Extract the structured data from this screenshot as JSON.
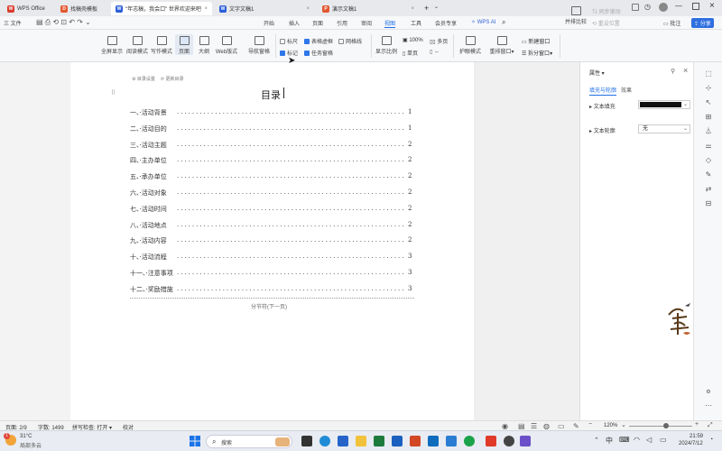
{
  "tabs": [
    {
      "label": "WPS Office",
      "color": "#d93a2b"
    },
    {
      "label": "找稿壳模板",
      "color": "#e3572f"
    },
    {
      "label": "\"年志稿，我会口\" 世界欢迎来吧!...",
      "color": "#2b5fd9",
      "active": true
    },
    {
      "label": "文字文稿1",
      "color": "#2b5fd9"
    },
    {
      "label": "演示文稿1",
      "color": "#e3572f"
    }
  ],
  "topright": {
    "share": "分享"
  },
  "menubar": {
    "file": "三 文件",
    "items": [
      "开始",
      "插入",
      "页面",
      "引用",
      "审阅",
      "视图",
      "工具",
      "会员专享"
    ],
    "wps_ai": "WPS AI",
    "comments": "批注",
    "share": "分享"
  },
  "ribbon": {
    "buttons": [
      "全屏显示",
      "阅读模式",
      "写作模式",
      "页面",
      "大纲",
      "Web版式",
      "导航窗格"
    ],
    "checks": [
      {
        "label": "标尺",
        "checked": false
      },
      {
        "label": "标记",
        "checked": true
      },
      {
        "label": "表格虚框",
        "checked": true
      },
      {
        "label": "任务窗格",
        "checked": true
      },
      {
        "label": "网格线",
        "checked": false
      }
    ],
    "zoom": [
      "显示比例",
      "100%",
      "单页",
      "多页"
    ],
    "tools": [
      "护眼模式",
      "重排窗口",
      "新建窗口",
      "拆分窗口",
      "并排比较",
      "同步滚动",
      "重设位置"
    ]
  },
  "doc": {
    "page_tools": [
      "目录设置",
      "更新目录"
    ],
    "title": "目录",
    "toc": [
      {
        "title": "一、·活动背景",
        "page": "1"
      },
      {
        "title": "二、·活动目的",
        "page": "1"
      },
      {
        "title": "三、·活动主题",
        "page": "2"
      },
      {
        "title": "四、·主办单位",
        "page": "2"
      },
      {
        "title": "五、·承办单位",
        "page": "2"
      },
      {
        "title": "六、·活动对象",
        "page": "2"
      },
      {
        "title": "七、·活动时间",
        "page": "2"
      },
      {
        "title": "八、·活动地点",
        "page": "2"
      },
      {
        "title": "九、·活动内容",
        "page": "2"
      },
      {
        "title": "十、·活动流程",
        "page": "3"
      },
      {
        "title": "十一、·注意事项",
        "page": "3"
      },
      {
        "title": "十二、·奖励措施",
        "page": "3"
      }
    ],
    "section_break": "分节符(下一页)"
  },
  "panel": {
    "title": "属性 ▾",
    "tabs": [
      "填充与轮廓",
      "效果"
    ],
    "fill_label": "文本填充",
    "fill_color": "#111111",
    "outline_label": "文本轮廓",
    "outline_value": "无"
  },
  "status": {
    "page": "页面: 2/9",
    "words": "字数: 1499",
    "spell": "拼写检查: 打开 ▾",
    "proof": "校对",
    "zoom": "120%"
  },
  "taskbar": {
    "weather_temp": "31°C",
    "weather_text": "局部多云",
    "search": "搜索",
    "time": "21:59",
    "date": "2024/7/12",
    "lang": "中"
  }
}
